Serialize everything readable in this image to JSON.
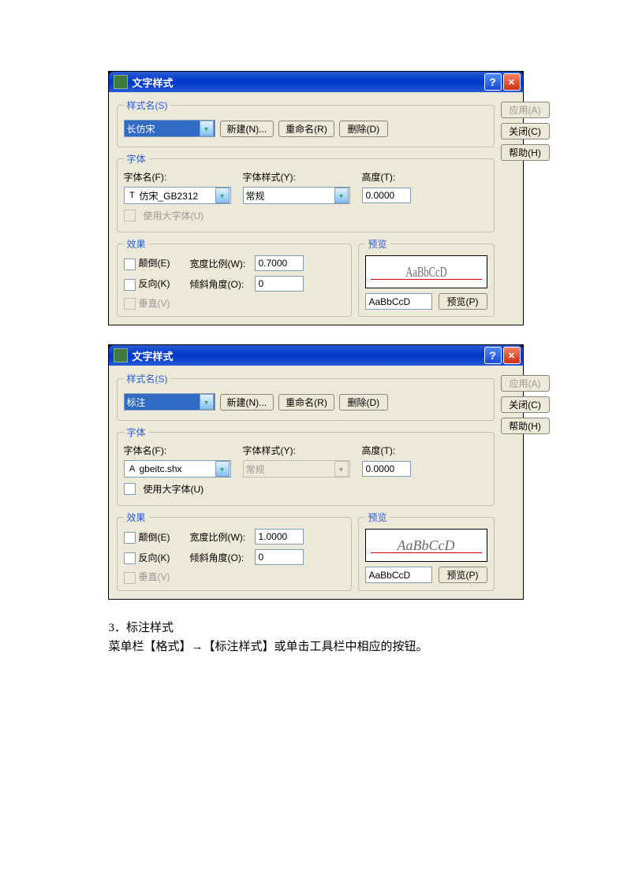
{
  "dialog_title": "文字样式",
  "groups": {
    "style_name": "样式名(S)",
    "font": "字体",
    "effects": "效果",
    "preview": "预览"
  },
  "labels": {
    "font_name": "字体名(F):",
    "font_style": "字体样式(Y):",
    "height": "高度(T):",
    "use_big_font": "使用大字体(U)",
    "upside_down": "颠倒(E)",
    "backwards": "反向(K)",
    "vertical": "垂直(V)",
    "width_factor": "宽度比例(W):",
    "oblique_angle": "倾斜角度(O):"
  },
  "buttons": {
    "new": "新建(N)...",
    "rename": "重命名(R)",
    "delete": "删除(D)",
    "apply": "应用(A)",
    "close": "关闭(C)",
    "help": "帮助(H)",
    "preview": "预览(P)"
  },
  "preview_sample": "AaBbCcD",
  "preview_input": "AaBbCcD",
  "dialog1": {
    "style_name": "长仿宋",
    "font_name": "仿宋_GB2312",
    "font_style": "常规",
    "height": "0.0000",
    "width_factor": "0.7000",
    "oblique_angle": "0",
    "font_style_enabled": true,
    "big_font_enabled": false
  },
  "dialog2": {
    "style_name": "标注",
    "font_name": "gbeitc.shx",
    "font_style": "常规",
    "height": "0.0000",
    "width_factor": "1.0000",
    "oblique_angle": "0",
    "font_style_enabled": false,
    "big_font_enabled": true
  },
  "body_text": {
    "line1": "3．标注样式",
    "line2": "菜单栏【格式】→【标注样式】或单击工具栏中相应的按钮。"
  }
}
